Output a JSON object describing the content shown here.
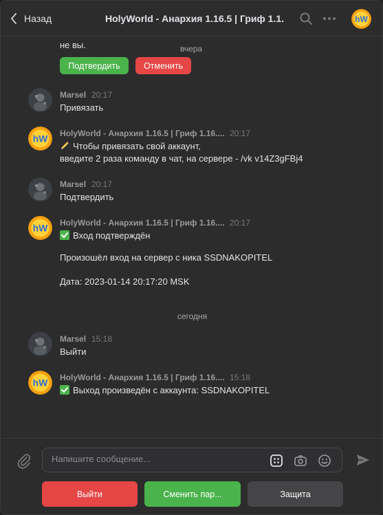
{
  "header": {
    "back_label": "Назад",
    "title": "HolyWorld - Анархия 1.16.5 | Гриф 1.1..."
  },
  "feed": {
    "partial_text": "не вы.",
    "confirm_label": "Подтвердить",
    "cancel_label": "Отменить",
    "date_yesterday": "вчера",
    "date_today": "сегодня",
    "messages": [
      {
        "author": "Marsel",
        "time": "20:17",
        "lines": [
          "Привязать"
        ]
      },
      {
        "author": "HolyWorld - Анархия 1.16.5 | Гриф 1.16....",
        "time": "20:17",
        "lines": [
          "Чтобы привязать свой аккаунт,",
          "введите 2 раза команду в чат, на сервере - /vk v14Z3gFBj4"
        ]
      },
      {
        "author": "Marsel",
        "time": "20:17",
        "lines": [
          "Подтвердить"
        ]
      },
      {
        "author": "HolyWorld - Анархия 1.16.5 | Гриф 1.16....",
        "time": "20:17",
        "lines": [
          "Вход подтверждён",
          "Произошёл вход на сервер с ника SSDNAKOPITEL",
          "Дата: 2023-01-14 20:17:20 MSK"
        ]
      },
      {
        "author": "Marsel",
        "time": "15:18",
        "lines": [
          "Выйти"
        ]
      },
      {
        "author": "HolyWorld - Анархия 1.16.5 | Гриф 1.16....",
        "time": "15:18",
        "lines": [
          "Выход произведён с аккаунта: SSDNAKOPITEL"
        ]
      }
    ]
  },
  "composer": {
    "placeholder": "Напишите сообщение..."
  },
  "keyboard": {
    "buttons": [
      "Выйти",
      "Сменить пар...",
      "Защита"
    ]
  },
  "colors": {
    "green": "#4bb34b",
    "red": "#e64646",
    "gray_button": "#454547",
    "check_green": "#4bb34b"
  },
  "icons": {
    "back": "chevron-left-icon",
    "search": "search-icon",
    "more": "more-horizontal-icon",
    "attach": "paperclip-icon",
    "keyboard": "keyboard-grid-icon",
    "camera": "camera-icon",
    "smile": "smile-icon",
    "send": "send-icon",
    "pencil": "pencil-emoji-icon",
    "check": "check-mark-emoji-icon"
  }
}
